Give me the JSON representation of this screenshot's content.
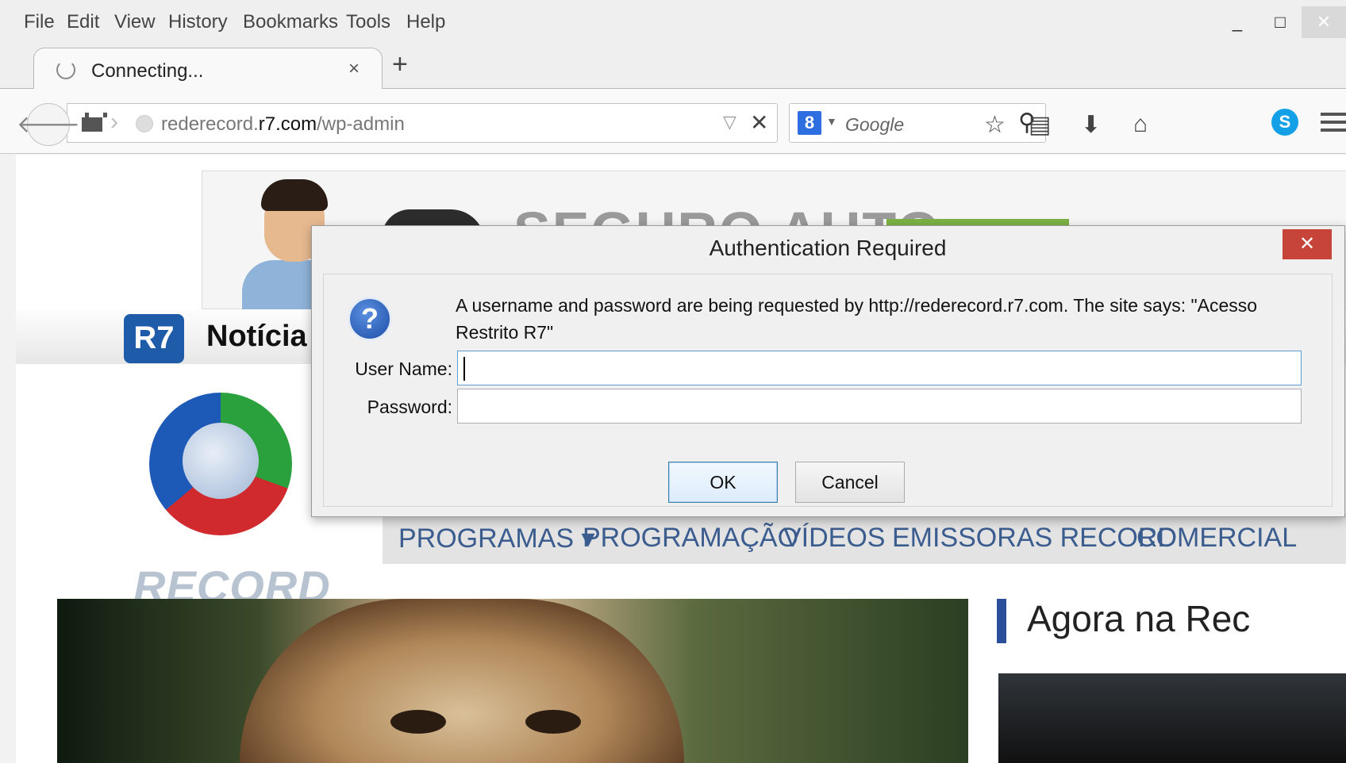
{
  "menubar": {
    "items": [
      "File",
      "Edit",
      "View",
      "History",
      "Bookmarks",
      "Tools",
      "Help"
    ]
  },
  "window_controls": {
    "minimize": "_",
    "maximize": "□",
    "close": "✕"
  },
  "tab": {
    "title": "Connecting...",
    "close": "×"
  },
  "new_tab": "+",
  "urlbar": {
    "url_prefix": "rederecord.",
    "url_domain": "r7.com",
    "url_path": "/wp-admin",
    "dropdown": "▽",
    "stop": "✕"
  },
  "search": {
    "engine_badge": "8",
    "placeholder": "Google"
  },
  "page": {
    "ad_text": "SEGURO AUTO",
    "r7_logo": "R7",
    "r7_title": "Notícia",
    "record_wordmark": "RECORD",
    "nav": [
      "PROGRAMAS ▾",
      "PROGRAMAÇÃO",
      "VÍDEOS",
      "EMISSORAS RECORD",
      "COMERCIAL"
    ],
    "side_title": "Agora na Rec"
  },
  "dialog": {
    "title": "Authentication Required",
    "close": "✕",
    "message": "A username and password are being requested by http://rederecord.r7.com. The site says: \"Acesso Restrito R7\"",
    "username_label": "User Name:",
    "username_value": "",
    "password_label": "Password:",
    "password_value": "",
    "ok_label": "OK",
    "cancel_label": "Cancel"
  },
  "colors": {
    "dialog_close": "#c7443a",
    "nav_link": "#3b5c8e",
    "r7_blue": "#1e5ba8",
    "skype": "#14a0e6"
  }
}
